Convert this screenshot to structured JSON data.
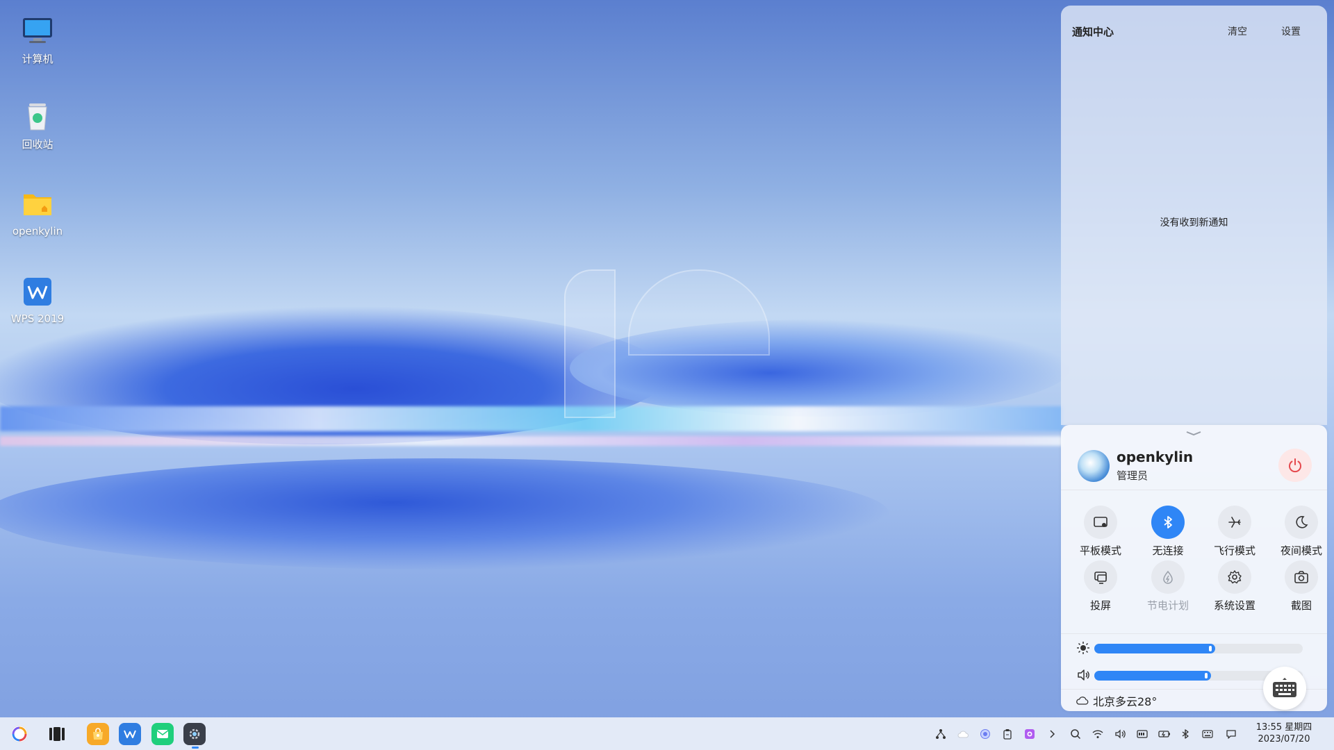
{
  "desktop": {
    "icons": [
      {
        "label": "计算机",
        "icon": "computer-icon"
      },
      {
        "label": "回收站",
        "icon": "recycle-bin-icon"
      },
      {
        "label": "openkylin",
        "icon": "home-folder-icon"
      },
      {
        "label": "WPS 2019",
        "icon": "wps-icon"
      }
    ]
  },
  "notification_center": {
    "title": "通知中心",
    "clear_label": "清空",
    "settings_label": "设置",
    "empty_text": "没有收到新通知"
  },
  "quick_panel": {
    "user": {
      "name": "openkylin",
      "role": "管理员"
    },
    "tiles": [
      {
        "label": "平板模式",
        "icon": "tablet-mode-icon",
        "state": "off"
      },
      {
        "label": "无连接",
        "icon": "bluetooth-icon",
        "state": "on"
      },
      {
        "label": "飞行模式",
        "icon": "airplane-icon",
        "state": "off"
      },
      {
        "label": "夜间模式",
        "icon": "moon-icon",
        "state": "off"
      },
      {
        "label": "投屏",
        "icon": "cast-screen-icon",
        "state": "off"
      },
      {
        "label": "节电计划",
        "icon": "power-saving-icon",
        "state": "disabled"
      },
      {
        "label": "系统设置",
        "icon": "gear-icon",
        "state": "off"
      },
      {
        "label": "截图",
        "icon": "camera-icon",
        "state": "off"
      }
    ],
    "brightness_level": 0.58,
    "volume_level": 0.56,
    "weather": "北京多云28°"
  },
  "taskbar": {
    "apps": [
      "start-menu-icon",
      "multitask-view-icon",
      "software-store-icon",
      "wps-icon",
      "mail-icon",
      "settings-app-icon"
    ],
    "tray": [
      "network-share-icon",
      "cloud-icon",
      "assistant-icon",
      "clipboard-icon",
      "screen-record-icon",
      "expand-arrow-icon",
      "search-icon",
      "wifi-icon",
      "volume-icon",
      "storage-icon",
      "battery-icon",
      "bluetooth-icon",
      "keyboard-icon",
      "message-icon"
    ],
    "time": "13:55 星期四",
    "date": "2023/07/20"
  },
  "colors": {
    "accent": "#2f86f6",
    "power": "#e5484d"
  }
}
